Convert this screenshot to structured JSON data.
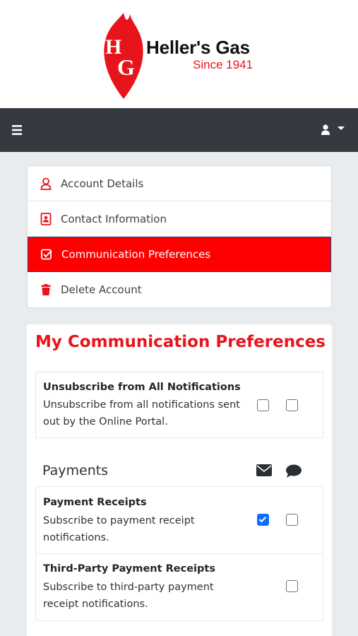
{
  "brand": {
    "name": "Heller's Gas",
    "since": "Since 1941",
    "monogram": "HG",
    "color": "#e8141b"
  },
  "navbar": {
    "menu_icon": "hamburger-icon",
    "user_icon": "user-icon",
    "caret_icon": "caret-down-icon"
  },
  "account_menu": {
    "items": [
      {
        "label": "Account Details",
        "icon": "user-icon",
        "active": false
      },
      {
        "label": "Contact Information",
        "icon": "address-card-icon",
        "active": false
      },
      {
        "label": "Communication Preferences",
        "icon": "check-square-icon",
        "active": true
      },
      {
        "label": "Delete Account",
        "icon": "trash-icon",
        "active": false
      }
    ],
    "active_color": "#ff0000"
  },
  "preferences": {
    "title": "My Communication Preferences",
    "unsubscribe": {
      "title": "Unsubscribe from All Notifications",
      "description": "Unsubscribe from all notifications sent out by the Online Portal.",
      "email_checked": false,
      "sms_checked": false
    },
    "sections": [
      {
        "label": "Payments",
        "column_icons": [
          "envelope-icon",
          "comment-icon"
        ],
        "rows": [
          {
            "title": "Payment Receipts",
            "description": "Subscribe to payment receipt notifications.",
            "email_checked": true,
            "sms_checked": false
          },
          {
            "title": "Third-Party Payment Receipts",
            "description": "Subscribe to third-party payment receipt notifications.",
            "email_available": false,
            "sms_checked": false
          }
        ]
      }
    ]
  }
}
